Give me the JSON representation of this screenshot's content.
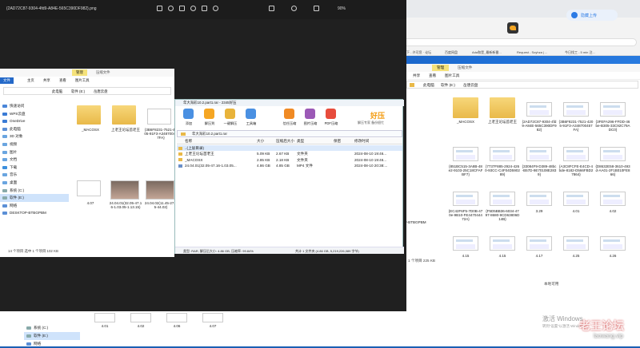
{
  "photos": {
    "title": "{2AD72C87-9304-4fd9-A84E-565C390DF982}.png",
    "zoom": "90%",
    "toolbar_icons": [
      "edit-icon",
      "rotate-icon",
      "delete-icon",
      "heart-icon",
      "share-icon",
      "more-icon",
      "fullscreen-icon",
      "zoom-out-icon",
      "zoom-in-icon"
    ]
  },
  "browser": {
    "bookmark_upload": "隐藏上传",
    "bookmarks": [
      "你要下 - 许可您 · 论坛",
      "百度网盘",
      "Ada和是_最新新番...",
      "Request - Soyhza | ...",
      "今日找工 - 5 min 注..."
    ]
  },
  "explorer_right": {
    "ribbon_tab": "管理",
    "ribbon_tab_sub": "压缩文件",
    "menu": [
      "共享",
      "查看",
      "图片工具"
    ],
    "path": [
      "此电脑",
      "软件 (E:)",
      "岳唐云盘"
    ],
    "files": [
      {
        "name": "_MACOSX",
        "kind": "folder"
      },
      {
        "name": "上老王论坛首老王",
        "kind": "folder"
      },
      {
        "name": "{2AD72C87-9304-4fd9-A84E-565C390DF982}",
        "kind": "img"
      },
      {
        "name": "{3B6F8231-7521-4205-91F3-A348700457FA}",
        "kind": "img"
      },
      {
        "name": "{3FEFA296-FFDD-46be-B305-33C92C79ADC0}",
        "kind": "img"
      },
      {
        "name": "{851BC515-3A8B-48e2-9103-25C18CFAFBF7}",
        "kind": "img"
      },
      {
        "name": "{7737F885-2924-4260-93CC-C4F04D590289}",
        "kind": "img"
      },
      {
        "name": "{33084F9-D389-48bc-B57D-9E70108E2839}",
        "kind": "img"
      },
      {
        "name": "{A3C8FCFE-E4CD-4bde-8182-D566FBD27864}",
        "kind": "img"
      },
      {
        "name": "{D8632E58-3610-493d-AA01-2F1B010FE866}",
        "kind": "img"
      },
      {
        "name": "{EC42F6F5-7D0B-470e-9B10-FE447044472A}",
        "kind": "img"
      },
      {
        "name": "{F5D5BB36-6034-4797-8680-9CD63806D14B}",
        "kind": "img"
      },
      {
        "name": "3.29",
        "kind": "img"
      },
      {
        "name": "4.01",
        "kind": "img"
      },
      {
        "name": "4.02",
        "kind": "img"
      },
      {
        "name": "4.15",
        "kind": "img"
      },
      {
        "name": "4.15",
        "kind": "img"
      },
      {
        "name": "4.17",
        "kind": "img"
      },
      {
        "name": "4.25",
        "kind": "img"
      },
      {
        "name": "4.26",
        "kind": "img"
      }
    ],
    "nav_left_item": "OP-BTBGPBM",
    "status": "1 个项目 225 KB",
    "status2": "本地可用",
    "watermark_activate": "激活 Windows",
    "watermark_activate_sub": "转到\"设置\"以激活 Windows。"
  },
  "explorer_left": {
    "ribbon_tab": "管理",
    "ribbon_tab_sub": "压缩文件",
    "menu": [
      "文件",
      "主页",
      "共享",
      "查看",
      "图片工具"
    ],
    "path": [
      "此电脑",
      "软件 (E:)",
      "岳唐云盘"
    ],
    "nav": [
      {
        "label": "快速访问",
        "color": "#4a86d8"
      },
      {
        "label": "WPS云盘",
        "color": "#3a7bd5"
      },
      {
        "label": "OneDrive",
        "color": "#3a7bd5"
      },
      {
        "label": "此电脑",
        "color": "#5b8fd6"
      },
      {
        "label": "3D 对象",
        "color": "#6aa5e0"
      },
      {
        "label": "视频",
        "color": "#6aa5e0"
      },
      {
        "label": "图片",
        "color": "#6aa5e0"
      },
      {
        "label": "文档",
        "color": "#6aa5e0"
      },
      {
        "label": "下载",
        "color": "#3c8fdd"
      },
      {
        "label": "音乐",
        "color": "#6aa5e0"
      },
      {
        "label": "桌面",
        "color": "#6aa5e0"
      },
      {
        "label": "系统 (C:)",
        "color": "#8aa"
      },
      {
        "label": "软件 (E:)",
        "color": "#8aa"
      },
      {
        "label": "网络",
        "color": "#5b8fd6"
      },
      {
        "label": "DESKTOP-BTBGPBM",
        "color": "#5b8fd6"
      }
    ],
    "files": [
      {
        "name": "_MACOSX",
        "kind": "folder"
      },
      {
        "name": "上老王论坛首老王",
        "kind": "folder"
      },
      {
        "name": "{3B6F8231-7521-4205-91F3-A348700457FA}",
        "kind": "img"
      },
      {
        "name": "4.07",
        "kind": "img"
      },
      {
        "name": "24.04.01(32.05-47.16-1.03.05-1.13.15)",
        "kind": "vid"
      },
      {
        "name": "24.04.02(11.45-27.25-44.02)",
        "kind": "vid"
      }
    ],
    "status": "14 个项目  选中 1 个项目 102 KB",
    "bottom_files": [
      "4.01",
      "4.02",
      "4.06",
      "4.07"
    ],
    "bottom_nav": [
      "系统 (C:)",
      "软件 (E:)",
      "网络"
    ]
  },
  "rar": {
    "title": "年大海彩10.2.part1.rar - 2345好压",
    "tools": [
      "添加",
      "解压到",
      "一键解压",
      "工具箱",
      "信任压缩",
      "图片压缩",
      "PDF压缩"
    ],
    "brand": "好压",
    "brand_sub": "解压专家 备份很忙",
    "path": "年大海彩10.2.part1.rar",
    "columns": [
      "名称",
      "大小",
      "压缩后大小",
      "类型",
      "保密",
      "修改时间"
    ],
    "rows": [
      {
        "name": "..(上层目录)",
        "size": "",
        "packed": "",
        "type": "",
        "secret": "",
        "time": ""
      },
      {
        "name": "上老王论坛首老王",
        "size": "5.09 KB",
        "packed": "2.67 KB",
        "type": "文件夹",
        "secret": "",
        "time": "2024-08-10 19:46..."
      },
      {
        "name": "_MACOSX",
        "size": "2.85 KB",
        "packed": "2.18 KB",
        "type": "文件夹",
        "secret": "",
        "time": "2024-08-10 19:46..."
      },
      {
        "name": "24.04.01(32.05-47.16-1.03.05...",
        "size": "4.86 GB",
        "packed": "4.85 GB",
        "type": "MP4 文件",
        "secret": "",
        "time": "2024-08-10 20:38:..."
      }
    ],
    "status_left": "类型: RAR, 解压后大小: 4.86 GB, 压缩率: 99.84%",
    "status_right": "共计 1 文件夹 (4.86 GB, 5,219,226,089 字节)"
  },
  "watermark": {
    "brand": "老王论坛",
    "site": "laowang.vip"
  }
}
